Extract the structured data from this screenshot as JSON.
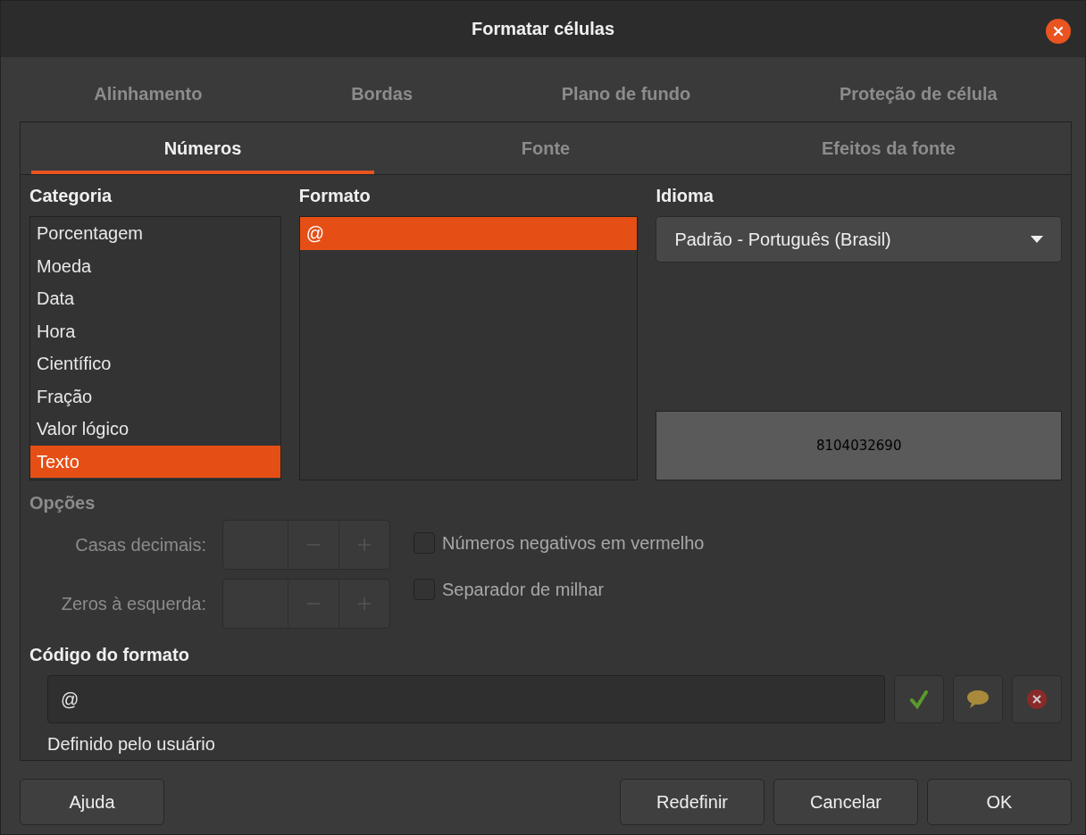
{
  "window": {
    "title": "Formatar células"
  },
  "tabs_top": [
    {
      "label": "Alinhamento",
      "selected": false
    },
    {
      "label": "Bordas",
      "selected": false
    },
    {
      "label": "Plano de fundo",
      "selected": false
    },
    {
      "label": "Proteção de célula",
      "selected": false
    }
  ],
  "tabs": [
    {
      "label": "Números",
      "selected": true
    },
    {
      "label": "Fonte",
      "selected": false
    },
    {
      "label": "Efeitos da fonte",
      "selected": false
    }
  ],
  "category": {
    "label": "Categoria",
    "items": [
      {
        "label": "Porcentagem",
        "selected": false
      },
      {
        "label": "Moeda",
        "selected": false
      },
      {
        "label": "Data",
        "selected": false
      },
      {
        "label": "Hora",
        "selected": false
      },
      {
        "label": "Científico",
        "selected": false
      },
      {
        "label": "Fração",
        "selected": false
      },
      {
        "label": "Valor lógico",
        "selected": false
      },
      {
        "label": "Texto",
        "selected": true
      }
    ]
  },
  "format": {
    "label": "Formato",
    "items": [
      {
        "label": "@",
        "selected": true
      }
    ]
  },
  "language": {
    "label": "Idioma",
    "value": "Padrão - Português (Brasil)"
  },
  "preview": "8104032690",
  "options": {
    "label": "Opções",
    "disabled": true,
    "spinners": [
      {
        "label": "Casas decimais:"
      },
      {
        "label": "Zeros à esquerda:"
      }
    ],
    "checkboxes": [
      {
        "label": "Números negativos em vermelho",
        "checked": false
      },
      {
        "label": "Separador de milhar",
        "checked": false
      }
    ]
  },
  "format_code": {
    "label": "Código do formato",
    "value": "@",
    "note": "Definido pelo usuário"
  },
  "help_button": "Ajuda",
  "buttons": [
    "Redefinir",
    "Cancelar",
    "OK"
  ]
}
